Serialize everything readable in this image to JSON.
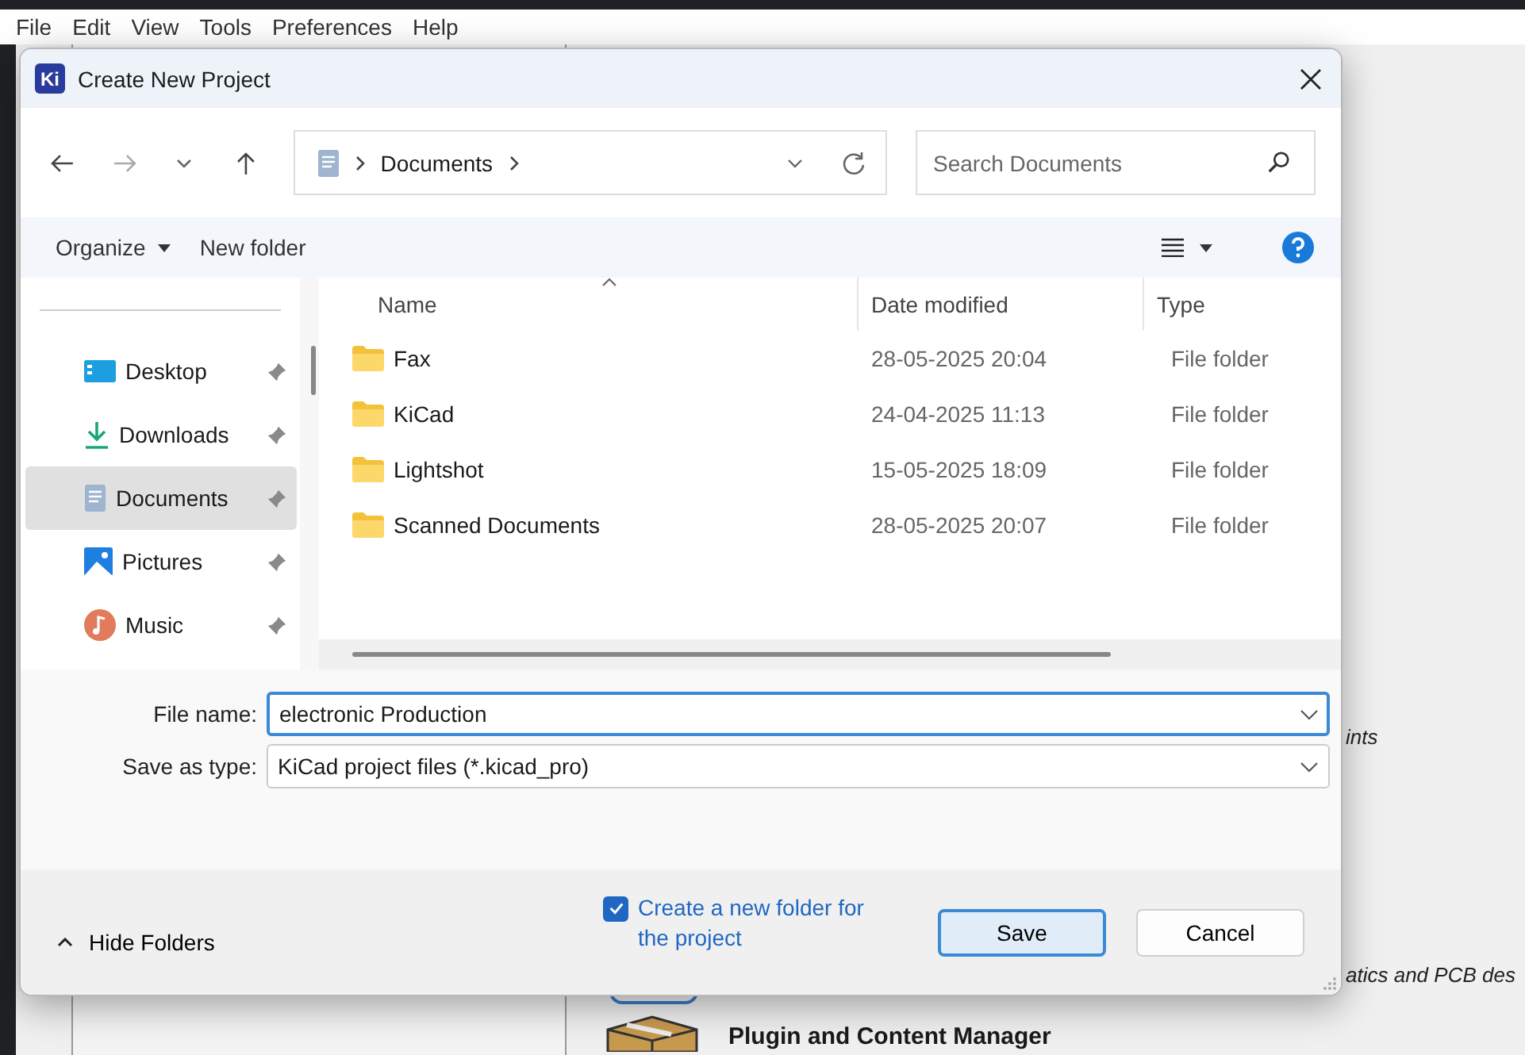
{
  "menu_bar": [
    "File",
    "Edit",
    "View",
    "Tools",
    "Preferences",
    "Help"
  ],
  "background": {
    "snippets": [
      "ints",
      "atics and PCB des"
    ],
    "heading": "Plugin and Content Manager"
  },
  "dialog": {
    "app_icon": "Ki",
    "title": "Create New Project",
    "address": {
      "segments": [
        "Documents"
      ]
    },
    "search": {
      "placeholder": "Search Documents"
    },
    "commands": [
      "Organize",
      "New folder"
    ],
    "sidebar": [
      {
        "label": "Desktop",
        "kind": "desktop",
        "selected": false
      },
      {
        "label": "Downloads",
        "kind": "downloads",
        "selected": false
      },
      {
        "label": "Documents",
        "kind": "documents",
        "selected": true
      },
      {
        "label": "Pictures",
        "kind": "pictures",
        "selected": false
      },
      {
        "label": "Music",
        "kind": "music",
        "selected": false
      }
    ],
    "columns": [
      "Name",
      "Date modified",
      "Type"
    ],
    "rows": [
      {
        "name": "Fax",
        "date": "28-05-2025 20:04",
        "type": "File folder"
      },
      {
        "name": "KiCad",
        "date": "24-04-2025 11:13",
        "type": "File folder"
      },
      {
        "name": "Lightshot",
        "date": "15-05-2025 18:09",
        "type": "File folder"
      },
      {
        "name": "Scanned Documents",
        "date": "28-05-2025 20:07",
        "type": "File folder"
      }
    ],
    "file_name": {
      "label": "File name:",
      "value": "electronic Production"
    },
    "save_as_type": {
      "label": "Save as type:",
      "value": "KiCad project files (*.kicad_pro)"
    },
    "hide_folders": "Hide Folders",
    "create_folder": {
      "label": "Create a new folder for the project",
      "checked": true
    },
    "buttons": [
      {
        "label": "Save",
        "kind": "default"
      },
      {
        "label": "Cancel",
        "kind": "normal"
      }
    ]
  }
}
